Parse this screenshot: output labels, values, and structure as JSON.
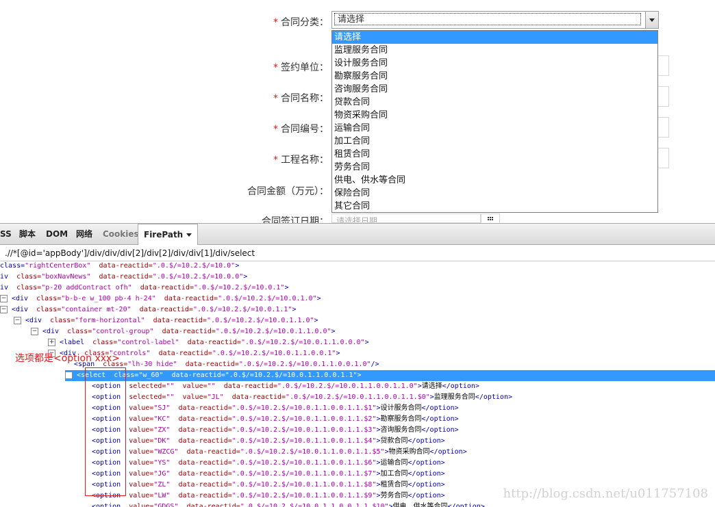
{
  "form": {
    "labels": {
      "category": "合同分类：",
      "signer": "签约单位：",
      "name": "合同名称：",
      "number": "合同编号：",
      "project": "工程名称：",
      "amount": "合同金额（万元）：",
      "sign_date": "合同签订日期："
    },
    "required_mark": "*",
    "category_select": {
      "value": "请选择",
      "options": [
        "请选择",
        "监理服务合同",
        "设计服务合同",
        "勘察服务合同",
        "咨询服务合同",
        "贷款合同",
        "物资采购合同",
        "运输合同",
        "加工合同",
        "租赁合同",
        "劳务合同",
        "供电、供水等合同",
        "保险合同",
        "其它合同"
      ],
      "highlighted_option": "请选择"
    },
    "date_placeholder": "请选择日期"
  },
  "devtools": {
    "tabs": [
      "SS",
      "脚本",
      "DOM",
      "网络",
      "Cookies",
      "FirePath"
    ],
    "active_tab": "FirePath",
    "xpath": ".//*[@id='appBody']/div/div/div[2]/div[2]/div/div[1]/div/select",
    "tree_lines": [
      "class=\"rightCenterBox\"  data-reactid=\".0.$/=10.2.$/=10.0\">",
      "iv  class=\"boxNavNews\"  data-reactid=\".0.$/=10.2.$/=10.0.0\">",
      "iv  class=\"p-20 addContract ofh\"  data-reactid=\".0.$/=10.2.$/=10.0.1\">",
      "<div  class=\"b-b-e w_100 pb-4 h-24\"  data-reactid=\".0.$/=10.2.$/=10.0.1.0\">",
      "<div  class=\"container mt-20\"  data-reactid=\".0.$/=10.2.$/=10.0.1.1\">",
      "<div  class=\"form-horizontal\"  data-reactid=\".0.$/=10.2.$/=10.0.1.1.0\">",
      "<div  class=\"control-group\"  data-reactid=\".0.$/=10.2.$/=10.0.1.1.0.0\">",
      "<label  class=\"control-label\"  data-reactid=\".0.$/=10.2.$/=10.0.1.1.0.0.0\">",
      "<div  class=\"controls\"  data-reactid=\".0.$/=10.2.$/=10.0.1.1.0.0.1\">",
      "<span  class=\"lh-30 hide\"  data-reactid=\".0.$/=10.2.$/=10.0.1.1.0.0.1.0\"/>",
      "<select  class=\"w_60\"  data-reactid=\".0.$/=10.2.$/=10.0.1.1.0.0.1.1\">",
      "<option  selected=\"\"  value=\"\"  data-reactid=\".0.$/=10.2.$/=10.0.1.1.0.0.1.1.0\">请选择</option>",
      "<option  selected=\"\"  value=\"JL\"  data-reactid=\".0.$/=10.2.$/=10.0.1.1.0.0.1.1.$0\">监理服务合同</option>",
      "<option  value=\"SJ\"  data-reactid=\".0.$/=10.2.$/=10.0.1.1.0.0.1.1.$1\">设计服务合同</option>",
      "<option  value=\"KC\"  data-reactid=\".0.$/=10.2.$/=10.0.1.1.0.0.1.1.$2\">勘察服务合同</option>",
      "<option  value=\"ZX\"  data-reactid=\".0.$/=10.2.$/=10.0.1.1.0.0.1.1.$3\">咨询服务合同</option>",
      "<option  value=\"DK\"  data-reactid=\".0.$/=10.2.$/=10.0.1.1.0.0.1.1.$4\">贷款合同</option>",
      "<option  value=\"WZCG\"  data-reactid=\".0.$/=10.2.$/=10.0.1.1.0.0.1.1.$5\">物资采购合同</option>",
      "<option  value=\"YS\"  data-reactid=\".0.$/=10.2.$/=10.0.1.1.0.0.1.1.$6\">运输合同</option>",
      "<option  value=\"JG\"  data-reactid=\".0.$/=10.2.$/=10.0.1.1.0.0.1.1.$7\">加工合同</option>",
      "<option  value=\"ZL\"  data-reactid=\".0.$/=10.2.$/=10.0.1.1.0.0.1.1.$8\">租赁合同</option>",
      "<option  value=\"LW\"  data-reactid=\".0.$/=10.2.$/=10.0.1.1.0.0.1.1.$9\">劳务合同</option>",
      "<option  value=\"GDGS\"  data-reactid=\".0.$/=10.2.$/=10.0.1.1.0.0.1.1.$10\">供电、供水等合同</option>"
    ],
    "annotation": "选项都是<option xxx>"
  },
  "watermark": "http://blog.csdn.net/u011757108",
  "colors": {
    "selection": "#3399ff",
    "required": "#e02020",
    "annotation": "#e01b1b"
  }
}
